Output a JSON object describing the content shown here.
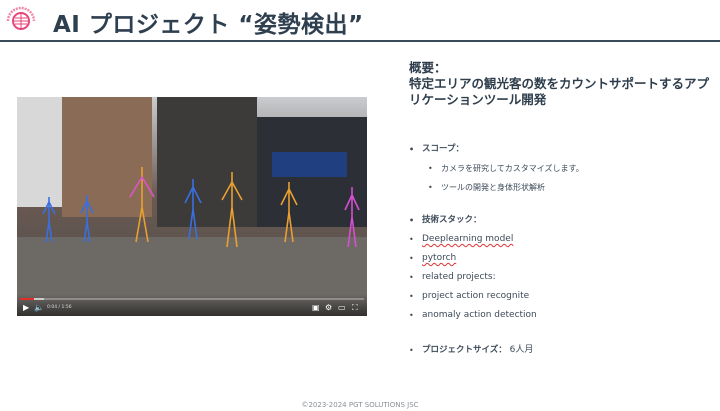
{
  "header": {
    "title": "AI プロジェクト “姿勢検出”",
    "logo_text": "PGT SOLUTIONS",
    "logo_sub": "VIETNAM"
  },
  "video": {
    "time": "0:04 / 1:56",
    "progress_pct": 4,
    "buffered_pct": 7,
    "accent": "#e52d27"
  },
  "info": {
    "overview_label": "概要：",
    "overview_text": "特定エリアの観光客の数をカウントサポートするアプリケーションツール開発",
    "scope_label": "スコープ：",
    "scope_items": [
      "カメラを研究してカスタマイズします。",
      "ツールの開発と身体形状解析"
    ],
    "tech_label": "技術スタック：",
    "tech_items": [
      "Deeplearning model",
      "pytorch",
      "related projects:",
      "project action recognite",
      "anomaly action detection"
    ],
    "size_label": "プロジェクトサイズ：",
    "size_value": "6人月"
  },
  "footer": "©2023-2024 PGT SOLUTIONS JSC"
}
